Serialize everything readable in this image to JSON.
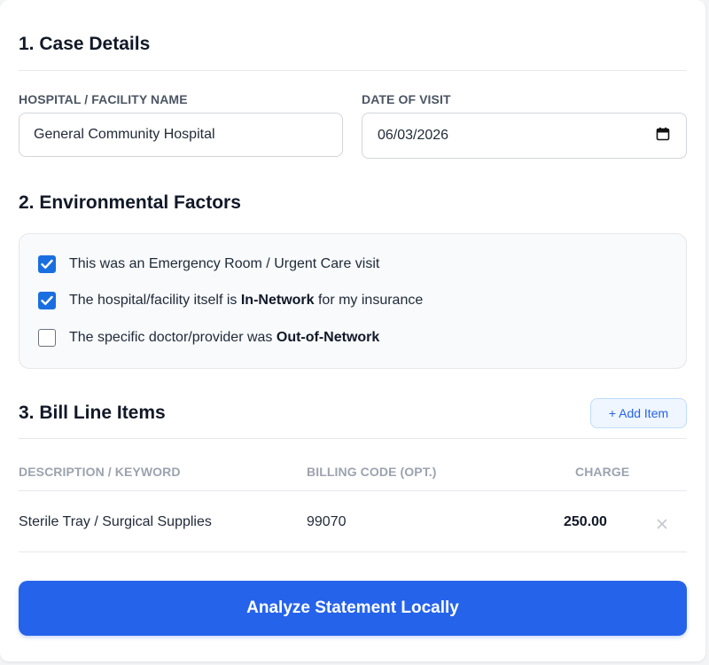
{
  "case_details": {
    "heading": "1. Case Details",
    "hospital_label": "HOSPITAL / FACILITY NAME",
    "hospital_value": "General Community Hospital",
    "date_label": "DATE OF VISIT",
    "date_value": "06/03/2026"
  },
  "environmental_factors": {
    "heading": "2. Environmental Factors",
    "options": [
      {
        "text": "This was an Emergency Room / Urgent Care visit",
        "checked": true
      },
      {
        "text_before": "The hospital/facility itself is ",
        "text_bold": "In-Network",
        "text_after": " for my insurance",
        "checked": true
      },
      {
        "text_before": "The specific doctor/provider was ",
        "text_bold": "Out-of-Network",
        "text_after": "",
        "checked": false
      }
    ]
  },
  "bill_line_items": {
    "heading": "3. Bill Line Items",
    "add_item_label": "+ Add Item",
    "columns": [
      "DESCRIPTION / KEYWORD",
      "BILLING CODE (OPT.)",
      "CHARGE"
    ],
    "rows": [
      {
        "description": "Sterile Tray / Surgical Supplies",
        "code": "99070",
        "charge": "250.00"
      }
    ],
    "remove_icon": "close-icon"
  },
  "analyze_button_label": "Analyze Statement Locally",
  "colors": {
    "accent": "#2563eb",
    "checkbox": "#1a6fe0",
    "panel_bg": "#f8fafc"
  }
}
